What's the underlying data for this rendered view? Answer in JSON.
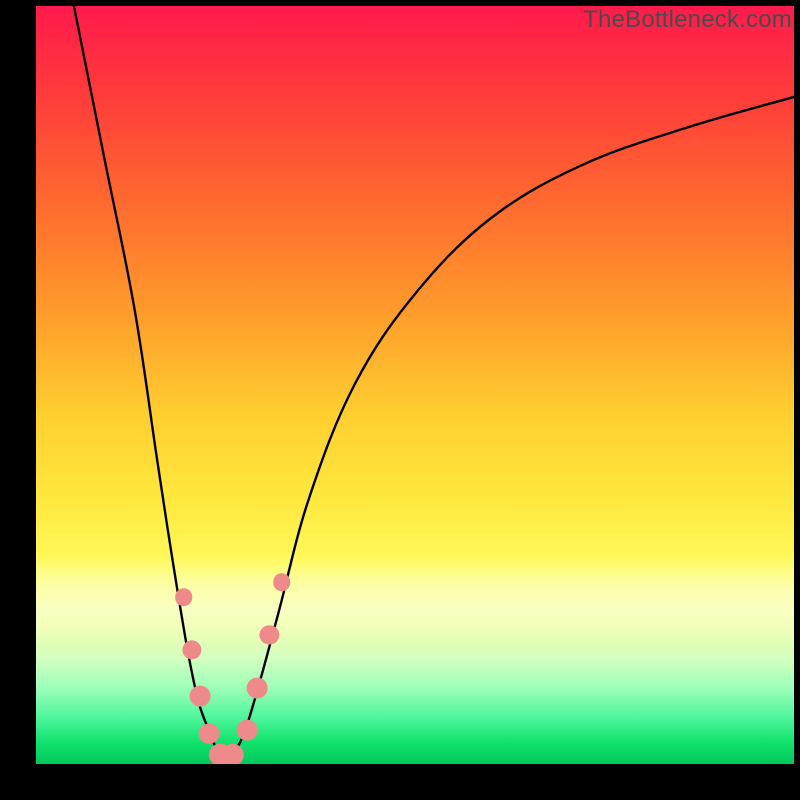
{
  "watermark": "TheBottleneck.com",
  "colors": {
    "frame": "#000000",
    "curve": "#000000",
    "dot": "#ef8a8b"
  },
  "chart_data": {
    "type": "line",
    "title": "",
    "xlabel": "",
    "ylabel": "",
    "xlim": [
      0,
      100
    ],
    "ylim": [
      0,
      100
    ],
    "series": [
      {
        "name": "left-branch",
        "x": [
          5,
          9,
          13,
          16,
          18,
          20,
          21.5,
          23,
          24,
          25
        ],
        "y": [
          100,
          80,
          60,
          40,
          27,
          15,
          8,
          4,
          1.5,
          0.3
        ]
      },
      {
        "name": "right-branch",
        "x": [
          25,
          27,
          29,
          32,
          36,
          42,
          50,
          60,
          72,
          86,
          100
        ],
        "y": [
          0.3,
          3,
          9,
          20,
          35,
          50,
          62,
          72,
          79,
          84,
          88
        ]
      }
    ],
    "markers": [
      {
        "x": 19.5,
        "y": 22,
        "r": 11
      },
      {
        "x": 20.6,
        "y": 15,
        "r": 12
      },
      {
        "x": 21.6,
        "y": 9,
        "r": 13
      },
      {
        "x": 22.8,
        "y": 4,
        "r": 13
      },
      {
        "x": 24.3,
        "y": 1.2,
        "r": 14
      },
      {
        "x": 26.0,
        "y": 1.2,
        "r": 14
      },
      {
        "x": 27.8,
        "y": 4.5,
        "r": 13
      },
      {
        "x": 29.2,
        "y": 10,
        "r": 13
      },
      {
        "x": 30.8,
        "y": 17,
        "r": 12
      },
      {
        "x": 32.4,
        "y": 24,
        "r": 11
      }
    ]
  }
}
